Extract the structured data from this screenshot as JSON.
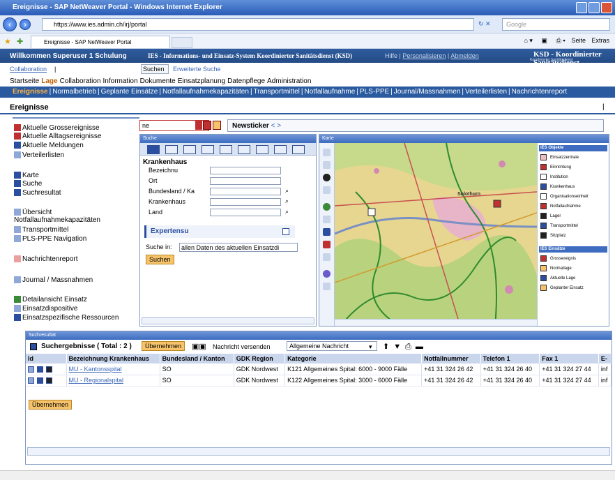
{
  "browser": {
    "window_title": "Ereignisse - SAP NetWeaver Portal - Windows Internet Explorer",
    "url": "https://www.ies.admin.ch/irj/portal",
    "tab_title": "Ereignisse - SAP NetWeaver Portal",
    "search_placeholder": "Google",
    "seite_label": "Seite",
    "extras_label": "Extras"
  },
  "portal": {
    "welcome": "Willkommen Superuser 1 Schulung",
    "system_name": "IES - Informations- und Einsatz-System Koordinierter Sanitätsdienst (KSD)",
    "links": {
      "hilfe": "Hilfe",
      "personalisieren": "Personalisieren",
      "abmelden": "Abmelden"
    },
    "brand": "KSD - Koordinierter Sanitätsdienst",
    "brand_sub": "Koordinierter Sanitätsdienst"
  },
  "collab": {
    "link": "Collaboration",
    "search_button": "Suchen",
    "advanced": "Erweiterte Suche"
  },
  "menu_top": [
    "Startseite",
    "Lage",
    "Collaboration",
    "Information",
    "Dokumente",
    "Einsatzplanung",
    "Datenpflege",
    "Administration"
  ],
  "menu_sub": [
    "Ereignisse",
    "Normalbetrieb",
    "Geplante Einsätze",
    "Notfallaufnahmekapazitäten",
    "Transportmittel",
    "Notfallaufnahme",
    "PLS-PPE",
    "Journal/Massnahmen",
    "Verteilerlisten",
    "Nachrichtenreport"
  ],
  "page_title": "Ereignisse",
  "leftnav": [
    {
      "label": "Aktuelle Grossereignisse",
      "color": "#c03030"
    },
    {
      "label": "Aktuelle Alltagsereignisse",
      "color": "#c03030"
    },
    {
      "label": "Aktuelle Meldungen",
      "color": "#2b4ea0"
    },
    {
      "label": "Verteilerlisten",
      "color": "#8ea9d8"
    },
    {
      "label": "Karte",
      "color": "#2b4ea0"
    },
    {
      "label": "Suche",
      "color": "#2b4ea0"
    },
    {
      "label": "Suchresultat",
      "color": "#2b4ea0"
    },
    {
      "label": "Übersicht Notfallaufnahmekapazitäten",
      "color": "#8ea9d8"
    },
    {
      "label": "Transportmittel",
      "color": "#8ea9d8"
    },
    {
      "label": "PLS-PPE Navigation",
      "color": "#8ea9d8"
    },
    {
      "label": "Nachrichtenreport",
      "color": "#e8a0a0"
    },
    {
      "label": "Journal / Massnahmen",
      "color": "#8ea9d8"
    },
    {
      "label": "Detailansicht Einsatz",
      "color": "#3a8a3a"
    },
    {
      "label": "Einsatzdispositive",
      "color": "#8ea9d8"
    },
    {
      "label": "Einsatzspezifische Ressourcen",
      "color": "#2b4ea0"
    }
  ],
  "toolbar": {
    "select_value": "ne",
    "newsticker": "Newsticker",
    "arrows": "< >"
  },
  "suche": {
    "title": "Suche",
    "section": "Krankenhaus",
    "fields": [
      "Bezeichnu",
      "Ort",
      "Bundesland / Ka",
      "Krankenhaus",
      "Land"
    ],
    "experten": "Expertensu",
    "suche_in_label": "Suche in:",
    "suche_in_value": "allen Daten des aktuellen Einsatzdi",
    "button": "Suchen"
  },
  "karte": {
    "title": "Karte",
    "city_label": "Solothurn",
    "legend_sections": [
      {
        "title": "IES Objekte",
        "items": [
          {
            "label": "Einsatzzentrale",
            "color": "#f0c0c0"
          },
          {
            "label": "Einrichtung",
            "color": "#c03030"
          },
          {
            "label": "Institution",
            "color": "#ffffff"
          },
          {
            "label": "Krankenhaus",
            "color": "#2b4ea0"
          },
          {
            "label": "Organisationseinheit",
            "color": "#ffffff"
          },
          {
            "label": "Notfallaufnahme",
            "color": "#c03030"
          },
          {
            "label": "Lager",
            "color": "#222222"
          },
          {
            "label": "Transportmittel",
            "color": "#2b4ea0"
          },
          {
            "label": "Sitzplatz",
            "color": "#222222"
          }
        ]
      },
      {
        "title": "IES Einsätze",
        "items": [
          {
            "label": "Grossereignis",
            "color": "#c03030"
          },
          {
            "label": "Normallage",
            "color": "#f6c36a"
          },
          {
            "label": "Aktuelle Lage",
            "color": "#2b4ea0"
          },
          {
            "label": "Geplanter Einsatz",
            "color": "#f6c36a"
          }
        ]
      }
    ]
  },
  "results": {
    "panel_title": "Suchresultat",
    "title": "Suchergebnisse ( Total : 2 )",
    "apply_button": "Übernehmen",
    "message_label": "Nachricht versenden",
    "message_type": "Allgemeine Nachricht",
    "columns": [
      "Bezeichnung Krankenhaus",
      "Bundesland / Kanton",
      "GDK Region",
      "Kategorie",
      "Notfallnummer",
      "Telefon 1",
      "Fax 1",
      "E-"
    ],
    "id_column": "Id",
    "rows": [
      [
        "MU - Kantonsspital",
        "SO",
        "GDK Nordwest",
        "K121 Allgemeines Spital: 6000 - 9000 Fälle",
        "+41 31 324 26 42",
        "+41 31 324 26 40",
        "+41 31 324 27 44",
        "inf"
      ],
      [
        "MU - Regionalspital",
        "SO",
        "GDK Nordwest",
        "K122 Allgemeines Spital: 3000 - 6000 Fälle",
        "+41 31 324 26 42",
        "+41 31 324 26 40",
        "+41 31 324 27 44",
        "inf"
      ]
    ],
    "bottom_button": "Übernehmen"
  }
}
